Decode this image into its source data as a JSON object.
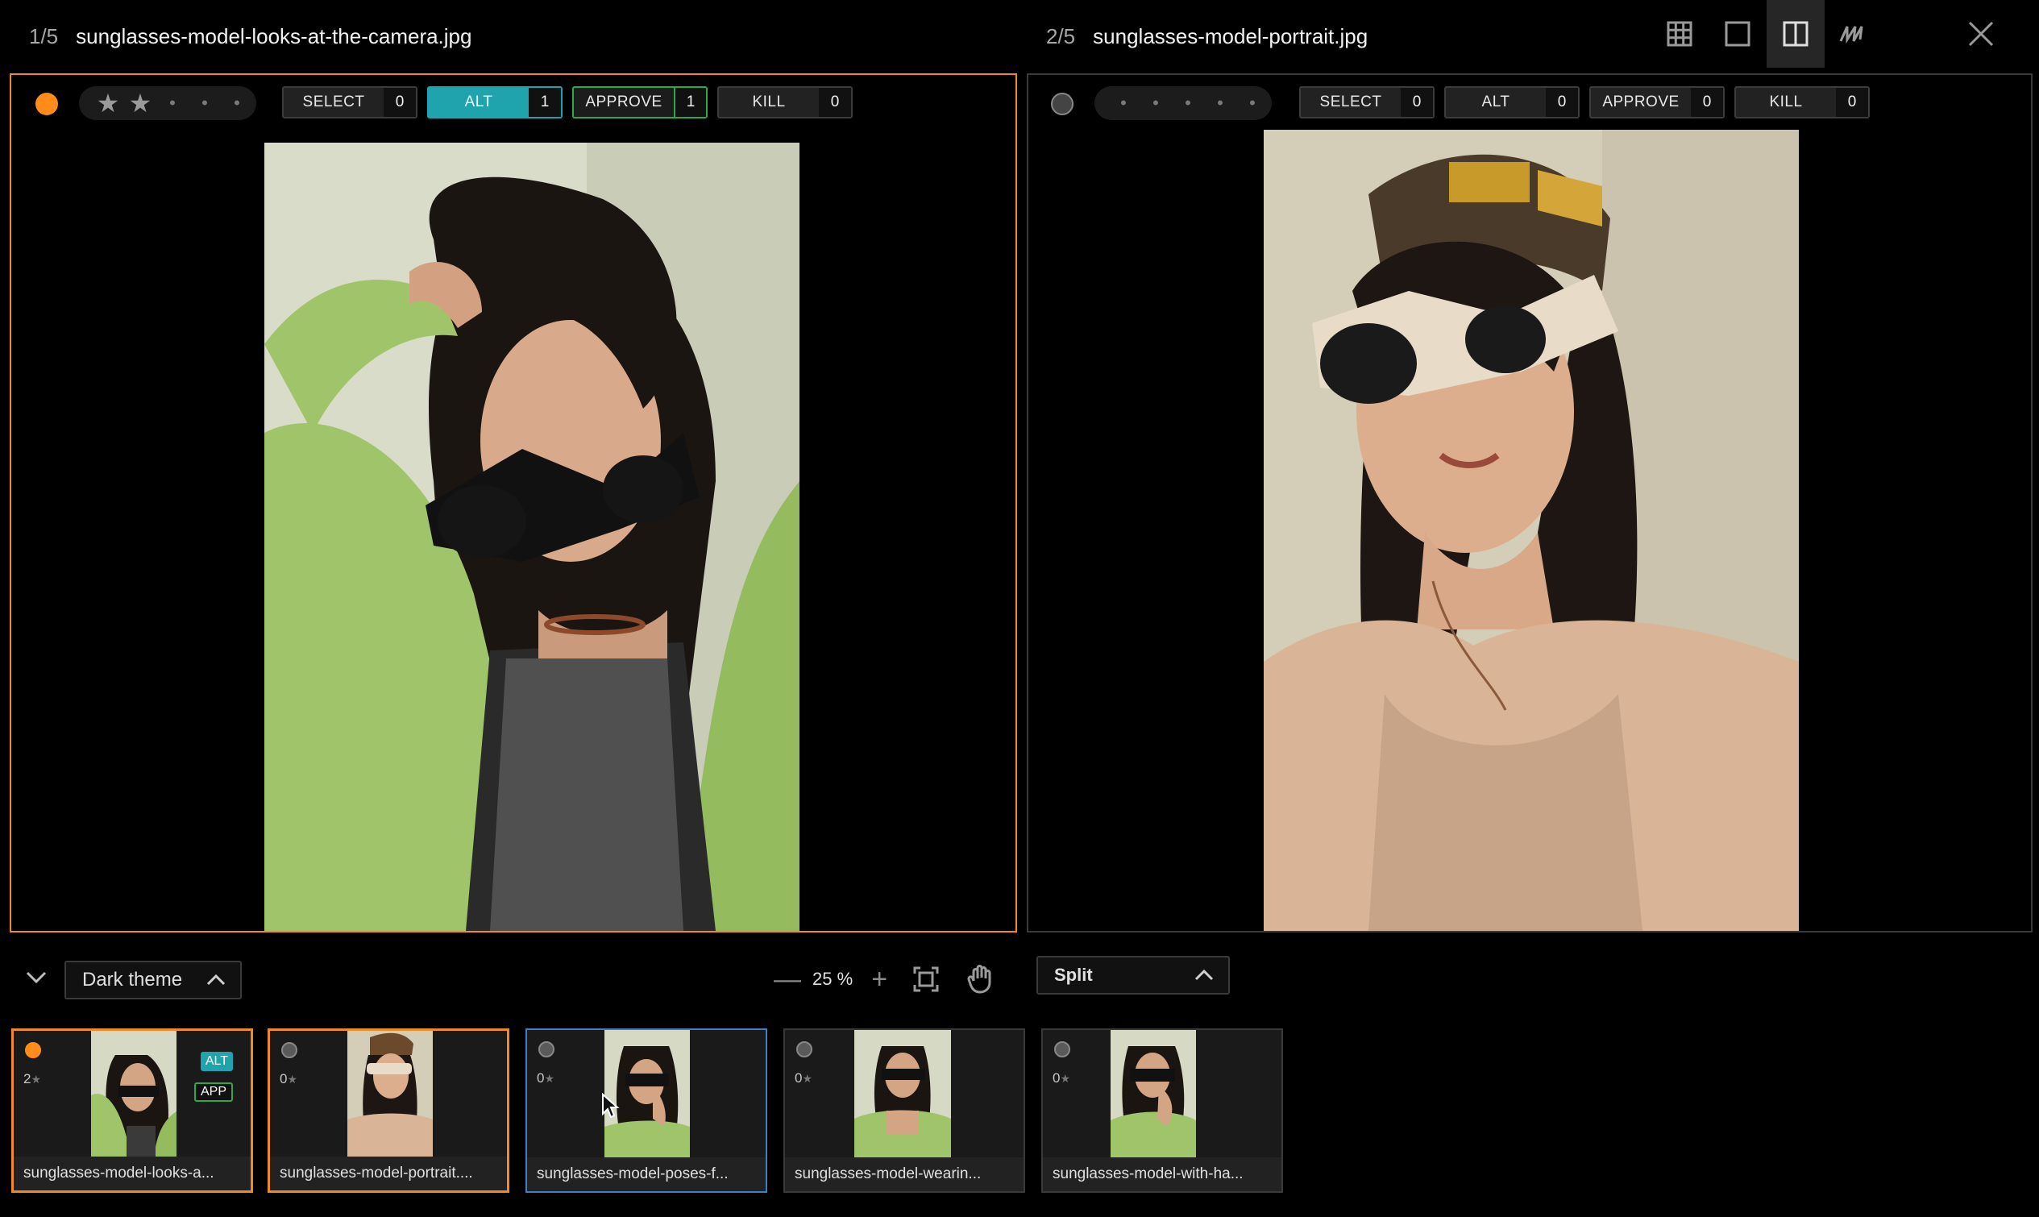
{
  "left": {
    "index": "1/5",
    "filename": "sunglasses-model-looks-at-the-camera.jpg",
    "stars": [
      "★",
      "★",
      "•",
      "•",
      "•"
    ],
    "tags": [
      {
        "label": "SELECT",
        "count": "0"
      },
      {
        "label": "ALT",
        "count": "1"
      },
      {
        "label": "APPROVE",
        "count": "1"
      },
      {
        "label": "KILL",
        "count": "0"
      }
    ]
  },
  "right": {
    "index": "2/5",
    "filename": "sunglasses-model-portrait.jpg",
    "stars": [
      "•",
      "•",
      "•",
      "•",
      "•"
    ],
    "tags": [
      {
        "label": "SELECT",
        "count": "0"
      },
      {
        "label": "ALT",
        "count": "0"
      },
      {
        "label": "APPROVE",
        "count": "0"
      },
      {
        "label": "KILL",
        "count": "0"
      }
    ]
  },
  "view_modes": [
    "grid-view-icon",
    "single-view-icon",
    "split-view-icon",
    "signature-icon"
  ],
  "active_view": "split-view-icon",
  "bottom": {
    "theme_label": "Dark theme",
    "zoom_value": "25",
    "zoom_unit": "%",
    "zoom_minus": "—",
    "zoom_plus": "+",
    "mode_label": "Split"
  },
  "filmstrip": [
    {
      "name": "sunglasses-model-looks-a...",
      "count": "2",
      "star": "★",
      "badges": [
        "ALT",
        "APP"
      ]
    },
    {
      "name": "sunglasses-model-portrait....",
      "count": "0",
      "star": "★"
    },
    {
      "name": "sunglasses-model-poses-f...",
      "count": "0",
      "star": "★"
    },
    {
      "name": "sunglasses-model-wearin...",
      "count": "0",
      "star": "★"
    },
    {
      "name": "sunglasses-model-with-ha...",
      "count": "0",
      "star": "★"
    }
  ],
  "colors": {
    "accent_orange": "#f08a24",
    "alt_teal": "#1fa3ad",
    "approve_green": "#2da84f",
    "current_blue": "#3f7fc4"
  }
}
